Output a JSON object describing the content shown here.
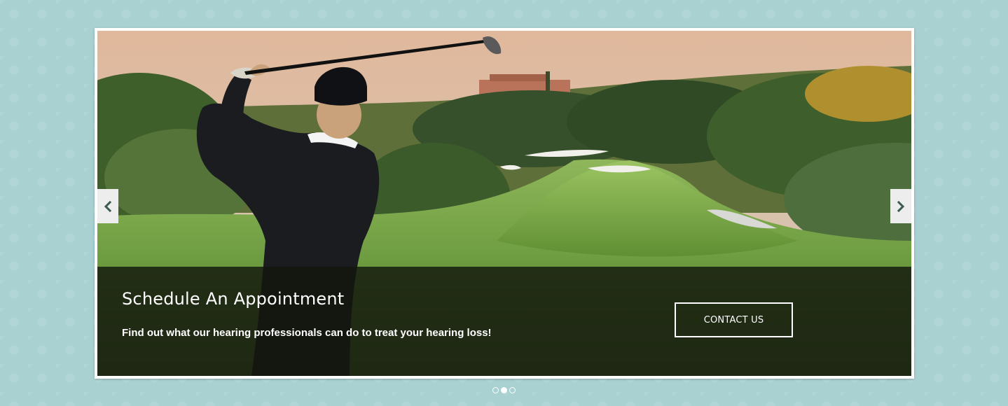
{
  "slider": {
    "caption": {
      "title": "Schedule An Appointment",
      "text": "Find out what our hearing professionals can do to treat your hearing loss!",
      "button_label": "CONTACT US"
    },
    "nav": {
      "prev_icon": "chevron-left-icon",
      "next_icon": "chevron-right-icon"
    },
    "dots": {
      "count": 3,
      "active_index": 1
    },
    "colors": {
      "page_background": "#a9d1d2",
      "caption_overlay": "#14160e",
      "button_border": "#ffffff",
      "arrow_background": "#ededed",
      "arrow_icon": "#3a5a52"
    }
  }
}
